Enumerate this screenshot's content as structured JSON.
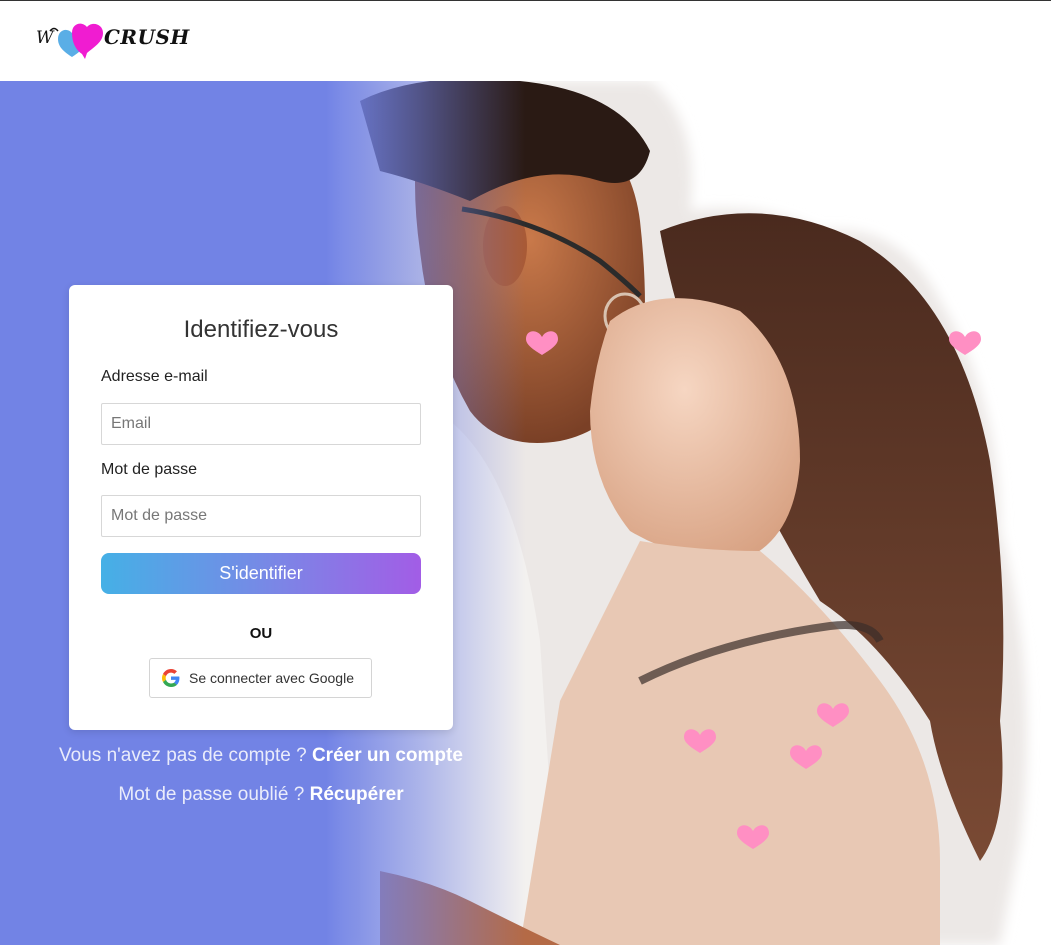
{
  "brand": {
    "name": "CRUSH",
    "logo_prefix": "W",
    "colors": {
      "blue_heart": "#5aaee6",
      "pink_heart": "#f01cd1"
    }
  },
  "theme": {
    "panel_color": "#7283e5",
    "heart_color": "#ff8fc3",
    "button_gradient": [
      "#45b0e6",
      "#a25de6"
    ]
  },
  "hero": {
    "image": "couple-photo",
    "decorations": "heart-icon"
  },
  "login": {
    "title": "Identifiez-vous",
    "email_label": "Adresse e-mail",
    "email_placeholder": "Email",
    "email_value": "",
    "password_label": "Mot de passe",
    "password_placeholder": "Mot de passe",
    "password_value": "",
    "submit_label": "S'identifier",
    "or_text": "OU",
    "google_label": "Se connecter avec Google",
    "google_icon": "google-g-icon"
  },
  "signup": {
    "prompt": "Vous n'avez pas de compte ?",
    "link": "Créer un compte"
  },
  "recover": {
    "prompt": "Mot de passe oublié ?",
    "link": "Récupérer"
  }
}
